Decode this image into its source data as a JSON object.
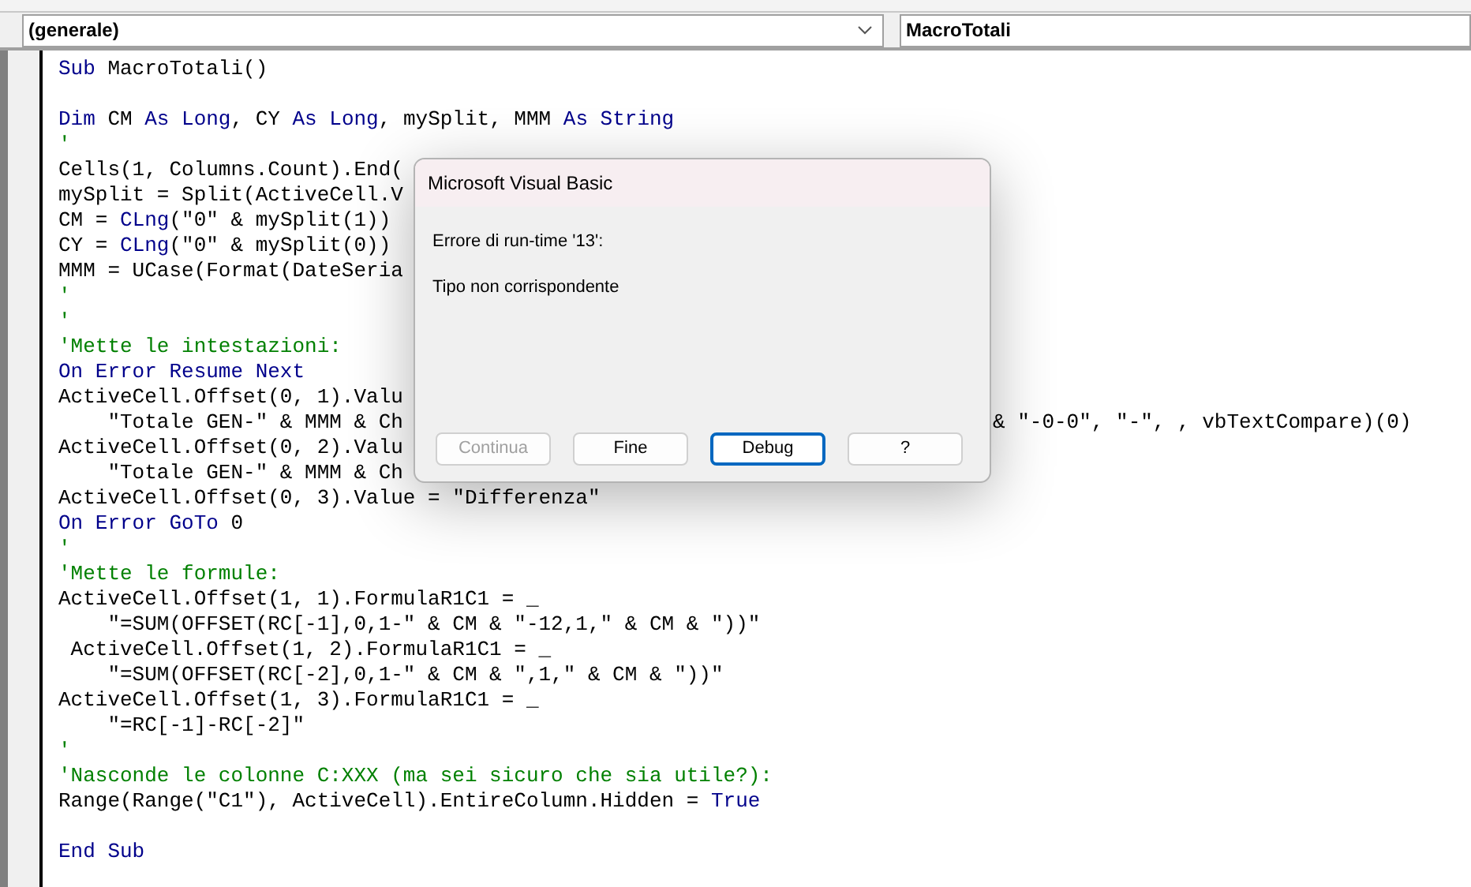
{
  "object_combo": {
    "value": "(generale)"
  },
  "procedure_combo": {
    "value": "MacroTotali"
  },
  "code_lines": [
    {
      "kind": "code",
      "segments": [
        {
          "kind": "kw",
          "text": "Sub"
        },
        {
          "kind": "plain",
          "text": " MacroTotali()"
        }
      ]
    },
    {
      "kind": "blank"
    },
    {
      "kind": "code",
      "segments": [
        {
          "kind": "kw",
          "text": "Dim"
        },
        {
          "kind": "plain",
          "text": " CM "
        },
        {
          "kind": "kw",
          "text": "As Long"
        },
        {
          "kind": "plain",
          "text": ", CY "
        },
        {
          "kind": "kw",
          "text": "As Long"
        },
        {
          "kind": "plain",
          "text": ", mySplit, MMM "
        },
        {
          "kind": "kw",
          "text": "As String"
        }
      ]
    },
    {
      "kind": "code",
      "segments": [
        {
          "kind": "comment",
          "text": "'"
        }
      ]
    },
    {
      "kind": "code",
      "segments": [
        {
          "kind": "plain",
          "text": "Cells(1, Columns.Count).End("
        }
      ]
    },
    {
      "kind": "code",
      "segments": [
        {
          "kind": "plain",
          "text": "mySplit = Split(ActiveCell.V"
        }
      ]
    },
    {
      "kind": "code",
      "segments": [
        {
          "kind": "plain",
          "text": "CM = "
        },
        {
          "kind": "kw",
          "text": "CLng"
        },
        {
          "kind": "plain",
          "text": "(\"0\" & mySplit(1))"
        }
      ]
    },
    {
      "kind": "code",
      "segments": [
        {
          "kind": "plain",
          "text": "CY = "
        },
        {
          "kind": "kw",
          "text": "CLng"
        },
        {
          "kind": "plain",
          "text": "(\"0\" & mySplit(0))"
        }
      ]
    },
    {
      "kind": "code",
      "segments": [
        {
          "kind": "plain",
          "text": "MMM = UCase(Format(DateSeria"
        }
      ]
    },
    {
      "kind": "code",
      "segments": [
        {
          "kind": "comment",
          "text": "'"
        }
      ]
    },
    {
      "kind": "code",
      "segments": [
        {
          "kind": "comment",
          "text": "'"
        }
      ]
    },
    {
      "kind": "code",
      "segments": [
        {
          "kind": "comment",
          "text": "'Mette le intestazioni:"
        }
      ]
    },
    {
      "kind": "code",
      "segments": [
        {
          "kind": "kw",
          "text": "On Error Resume Next"
        }
      ]
    },
    {
      "kind": "code",
      "segments": [
        {
          "kind": "plain",
          "text": "ActiveCell.Offset(0, 1).Valu"
        }
      ]
    },
    {
      "kind": "code",
      "segments": [
        {
          "kind": "plain",
          "text": "    \"Totale GEN-\" & MMM & Ch"
        }
      ],
      "right": [
        {
          "kind": "plain",
          "text": "& \"-0-0\", \"-\", , vbTextCompare)(0)"
        }
      ]
    },
    {
      "kind": "code",
      "segments": [
        {
          "kind": "plain",
          "text": "ActiveCell.Offset(0, 2).Valu"
        }
      ]
    },
    {
      "kind": "code",
      "segments": [
        {
          "kind": "plain",
          "text": "    \"Totale GEN-\" & MMM & Ch"
        }
      ]
    },
    {
      "kind": "code",
      "segments": [
        {
          "kind": "plain",
          "text": "ActiveCell.Offset(0, 3).Value = \"Differenza\""
        }
      ]
    },
    {
      "kind": "code",
      "segments": [
        {
          "kind": "kw",
          "text": "On Error GoTo"
        },
        {
          "kind": "plain",
          "text": " 0"
        }
      ]
    },
    {
      "kind": "code",
      "segments": [
        {
          "kind": "comment",
          "text": "'"
        }
      ]
    },
    {
      "kind": "code",
      "segments": [
        {
          "kind": "comment",
          "text": "'Mette le formule:"
        }
      ]
    },
    {
      "kind": "code",
      "segments": [
        {
          "kind": "plain",
          "text": "ActiveCell.Offset(1, 1).FormulaR1C1 = _"
        }
      ]
    },
    {
      "kind": "code",
      "segments": [
        {
          "kind": "plain",
          "text": "    \"=SUM(OFFSET(RC[-1],0,1-\" & CM & \"-12,1,\" & CM & \"))\""
        }
      ]
    },
    {
      "kind": "code",
      "segments": [
        {
          "kind": "plain",
          "text": " ActiveCell.Offset(1, 2).FormulaR1C1 = _"
        }
      ]
    },
    {
      "kind": "code",
      "segments": [
        {
          "kind": "plain",
          "text": "    \"=SUM(OFFSET(RC[-2],0,1-\" & CM & \",1,\" & CM & \"))\""
        }
      ]
    },
    {
      "kind": "code",
      "segments": [
        {
          "kind": "plain",
          "text": "ActiveCell.Offset(1, 3).FormulaR1C1 = _"
        }
      ]
    },
    {
      "kind": "code",
      "segments": [
        {
          "kind": "plain",
          "text": "    \"=RC[-1]-RC[-2]\""
        }
      ]
    },
    {
      "kind": "code",
      "segments": [
        {
          "kind": "comment",
          "text": "'"
        }
      ]
    },
    {
      "kind": "code",
      "segments": [
        {
          "kind": "comment",
          "text": "'Nasconde le colonne C:XXX (ma sei sicuro che sia utile?):"
        }
      ]
    },
    {
      "kind": "code",
      "segments": [
        {
          "kind": "plain",
          "text": "Range(Range(\"C1\"), ActiveCell).EntireColumn.Hidden = "
        },
        {
          "kind": "kw",
          "text": "True"
        }
      ]
    },
    {
      "kind": "blank"
    },
    {
      "kind": "code",
      "segments": [
        {
          "kind": "kw",
          "text": "End Sub"
        }
      ]
    }
  ],
  "dialog": {
    "title": "Microsoft Visual Basic",
    "message": "Errore di run-time '13':",
    "detail": "Tipo non corrispondente",
    "buttons": [
      {
        "label": "Continua",
        "disabled": true,
        "default": false
      },
      {
        "label": "Fine",
        "disabled": false,
        "default": false
      },
      {
        "label": "Debug",
        "disabled": false,
        "default": true
      },
      {
        "label": "?",
        "disabled": false,
        "default": false
      }
    ]
  }
}
